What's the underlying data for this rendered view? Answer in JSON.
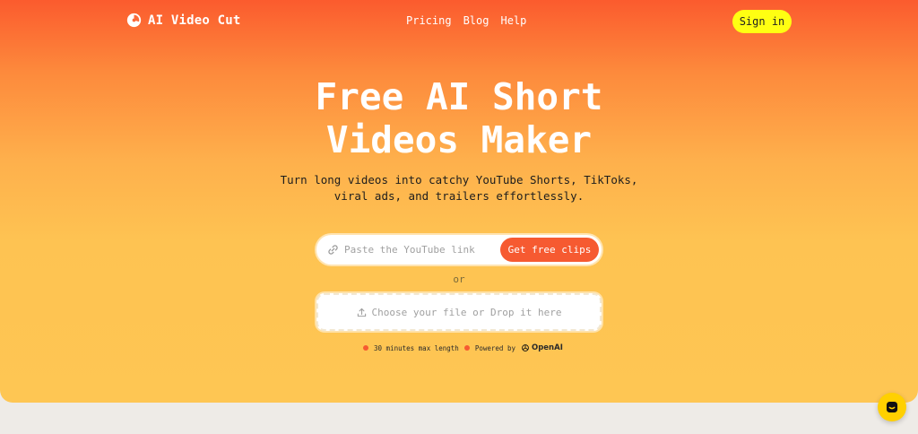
{
  "header": {
    "brand": "AI Video Cut",
    "nav": [
      "Pricing",
      "Blog",
      "Help"
    ],
    "signin_label": "Sign in"
  },
  "hero": {
    "title_line1": "Free AI Short",
    "title_line2": "Videos Maker",
    "subtitle_line1": "Turn long videos into catchy YouTube Shorts, TikToks,",
    "subtitle_line2": "viral ads, and trailers effortlessly."
  },
  "url_form": {
    "placeholder": "Paste the YouTube link",
    "button_label": "Get free clips",
    "icon": "link-icon"
  },
  "or_label": "or",
  "upload": {
    "label": "Choose your file or Drop it here",
    "icon": "upload-icon"
  },
  "meta": {
    "limit": "30 minutes max length",
    "powered_by": "Powered by",
    "provider": "OpenAI"
  },
  "chat": {
    "icon": "chat-icon"
  },
  "colors": {
    "accent": "#f65a31",
    "signin_bg": "#ffff12",
    "gradient_top": "#fb5b2e",
    "gradient_bottom": "#fec653",
    "chat_bg": "#ffd000"
  }
}
